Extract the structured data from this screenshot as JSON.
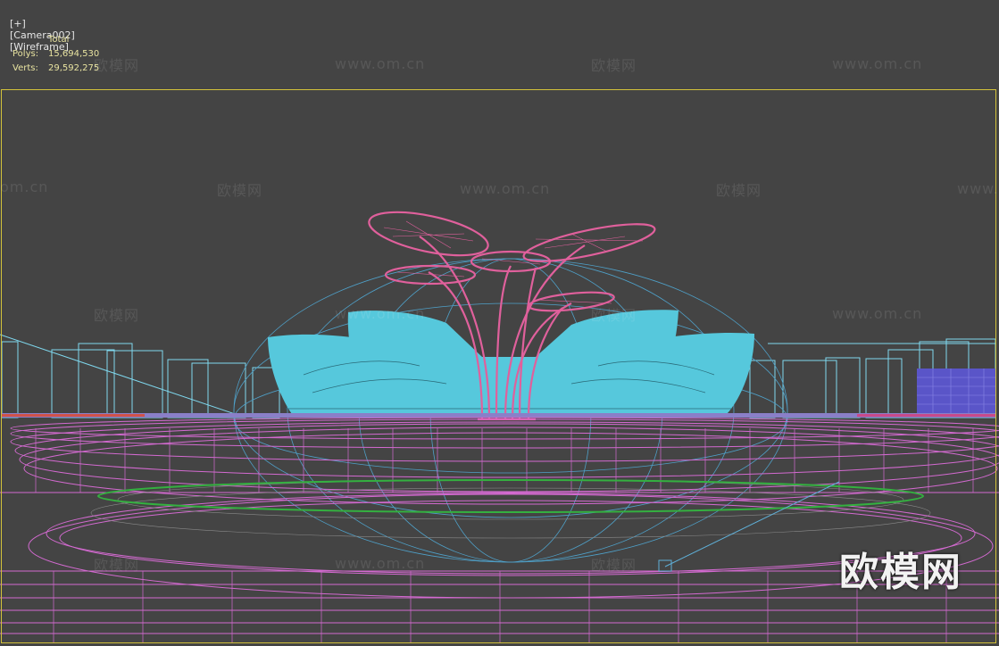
{
  "viewport": {
    "menu_plus": "[+]",
    "camera": "[Camera002]",
    "shading": "[Wireframe]"
  },
  "stats": {
    "header": "Total",
    "polys_label": "Polys:",
    "polys_value": "15,694,530",
    "verts_label": "Verts:",
    "verts_value": "29,592,275"
  },
  "watermarks": {
    "cn": "欧模网",
    "url": "www.om.cn",
    "url_cut": "om.cn",
    "logo": "欧模网"
  },
  "colors": {
    "background": "#444444",
    "frame": "#d3c23a",
    "building": "#56c8dc",
    "tree": "#e0609c",
    "pink_wire": "#d36ad0",
    "green_ring": "#34b040",
    "blue_lines": "#5fb0d8",
    "buildings_outline": "#7fd8ee",
    "violet_block": "#5a55c8"
  }
}
